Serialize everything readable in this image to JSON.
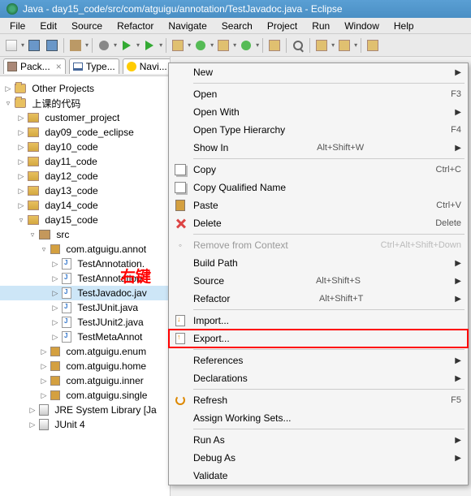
{
  "title": "Java - day15_code/src/com/atguigu/annotation/TestJavadoc.java - Eclipse",
  "menubar": [
    "File",
    "Edit",
    "Source",
    "Refactor",
    "Navigate",
    "Search",
    "Project",
    "Run",
    "Window",
    "Help"
  ],
  "tabs": {
    "pack": "Pack...",
    "type": "Type...",
    "navi": "Navi..."
  },
  "annotation_text": "右键",
  "tree": {
    "other_projects": "Other Projects",
    "top_folder": "上课的代码",
    "projects": [
      "customer_project",
      "day09_code_eclipse",
      "day10_code",
      "day11_code",
      "day12_code",
      "day13_code",
      "day14_code",
      "day15_code"
    ],
    "src": "src",
    "pkg_annotation": "com.atguigu.annot",
    "files": [
      "TestAnnotation.",
      "TestAnnotation",
      "TestJavadoc.jav",
      "TestJUnit.java",
      "TestJUnit2.java",
      "TestMetaAnnot"
    ],
    "other_pkgs": [
      "com.atguigu.enum",
      "com.atguigu.home",
      "com.atguigu.inner",
      "com.atguigu.single"
    ],
    "jre": "JRE System Library [Ja",
    "junit": "JUnit 4"
  },
  "context_menu": {
    "new": "New",
    "open": "Open",
    "open_sc": "F3",
    "open_with": "Open With",
    "open_type": "Open Type Hierarchy",
    "open_type_sc": "F4",
    "show_in": "Show In",
    "show_in_sc": "Alt+Shift+W",
    "copy": "Copy",
    "copy_sc": "Ctrl+C",
    "copy_qn": "Copy Qualified Name",
    "paste": "Paste",
    "paste_sc": "Ctrl+V",
    "delete": "Delete",
    "delete_sc": "Delete",
    "remove_ctx": "Remove from Context",
    "remove_ctx_sc": "Ctrl+Alt+Shift+Down",
    "build_path": "Build Path",
    "source": "Source",
    "source_sc": "Alt+Shift+S",
    "refactor": "Refactor",
    "refactor_sc": "Alt+Shift+T",
    "import": "Import...",
    "export": "Export...",
    "references": "References",
    "declarations": "Declarations",
    "refresh": "Refresh",
    "refresh_sc": "F5",
    "assign_ws": "Assign Working Sets...",
    "run_as": "Run As",
    "debug_as": "Debug As",
    "validate": "Validate"
  }
}
